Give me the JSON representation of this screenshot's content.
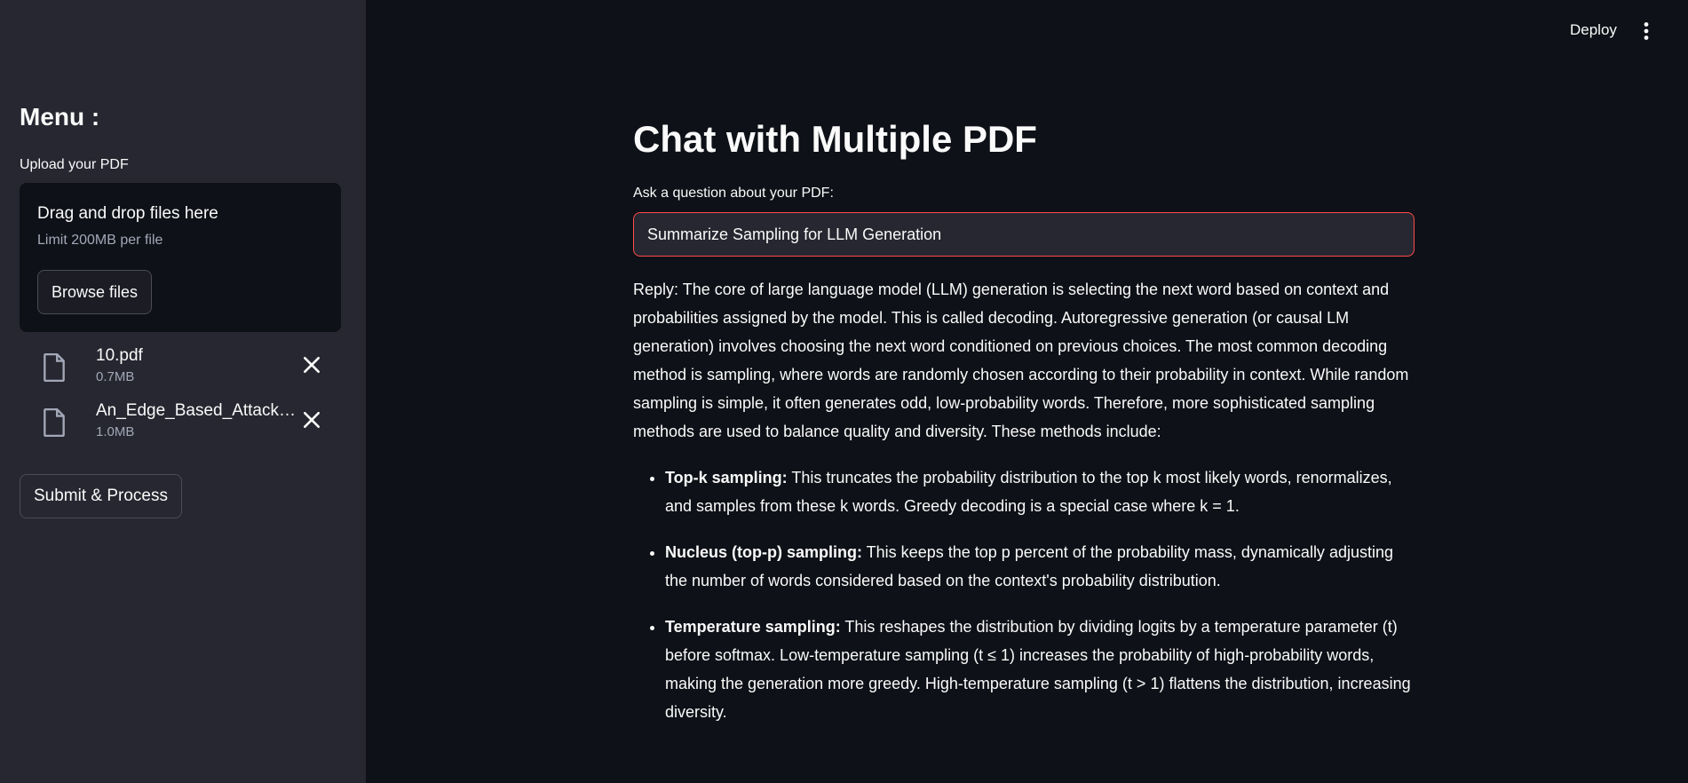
{
  "topbar": {
    "deploy_label": "Deploy",
    "menu_icon": "more-vertical-icon"
  },
  "sidebar": {
    "title": "Menu :",
    "upload_label": "Upload your PDF",
    "dropzone": {
      "title": "Drag and drop files here",
      "limit": "Limit 200MB per file",
      "browse_label": "Browse files"
    },
    "files": [
      {
        "name": "10.pdf",
        "size": "0.7MB"
      },
      {
        "name": "An_Edge_Based_Attack_...",
        "size": "1.0MB"
      }
    ],
    "submit_label": "Submit & Process"
  },
  "main": {
    "title": "Chat with Multiple PDF",
    "question_label": "Ask a question about your PDF:",
    "question_value": "Summarize Sampling for LLM Generation",
    "reply_intro": "Reply: The core of large language model (LLM) generation is selecting the next word based on context and probabilities assigned by the model. This is called decoding. Autoregressive generation (or causal LM generation) involves choosing the next word conditioned on previous choices. The most common decoding method is sampling, where words are randomly chosen according to their probability in context. While random sampling is simple, it often generates odd, low-probability words. Therefore, more sophisticated sampling methods are used to balance quality and diversity. These methods include:",
    "items": [
      {
        "term": "Top-k sampling:",
        "text": " This truncates the probability distribution to the top k most likely words, renormalizes, and samples from these k words. Greedy decoding is a special case where k = 1."
      },
      {
        "term": "Nucleus (top-p) sampling:",
        "text": " This keeps the top p percent of the probability mass, dynamically adjusting the number of words considered based on the context's probability distribution."
      },
      {
        "term": "Temperature sampling:",
        "text": " This reshapes the distribution by dividing logits by a temperature parameter (t) before softmax. Low-temperature sampling (t ≤ 1) increases the probability of high-probability words, making the generation more greedy. High-temperature sampling (t > 1) flattens the distribution, increasing diversity."
      }
    ]
  }
}
